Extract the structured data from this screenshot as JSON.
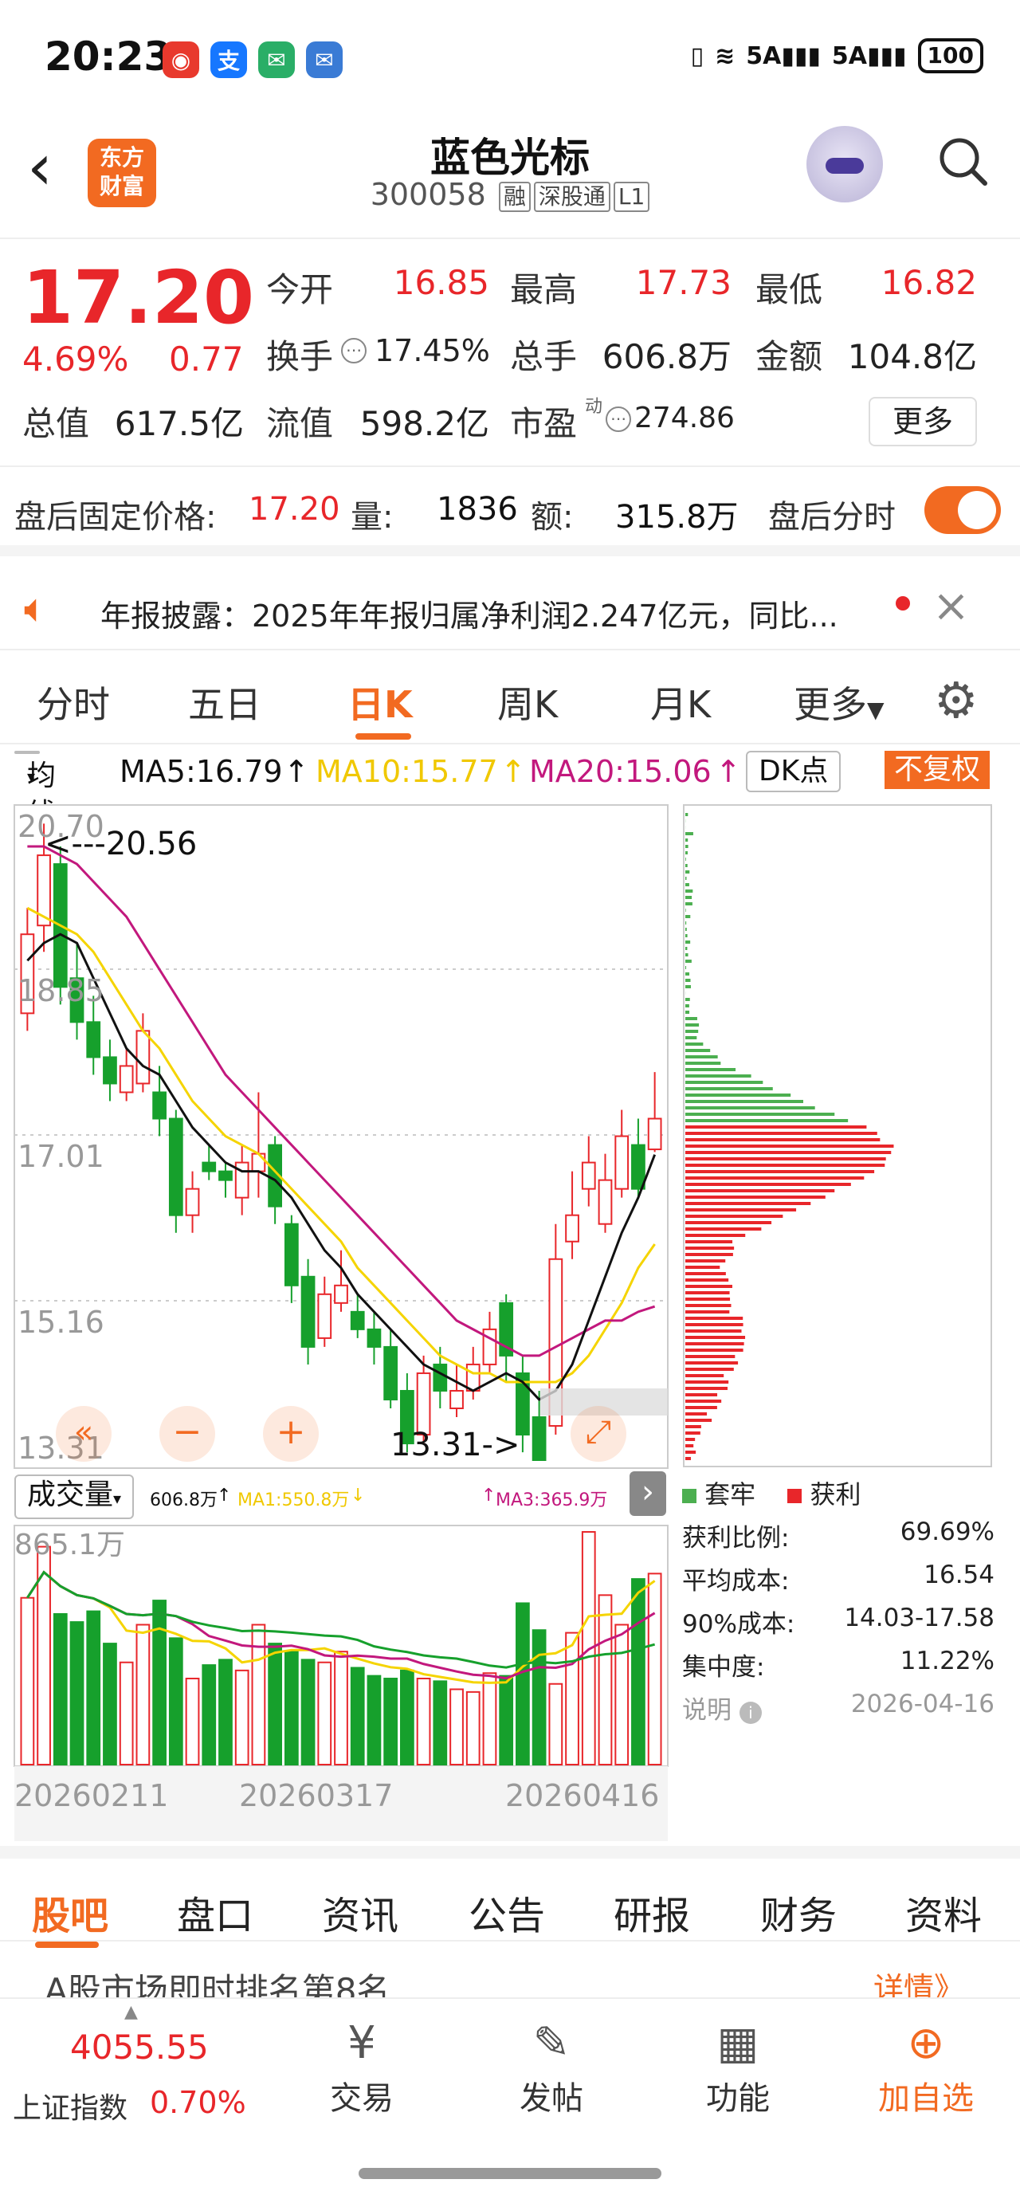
{
  "status": {
    "time": "20:23",
    "battery": "100",
    "net1": "5A",
    "net2": "5A"
  },
  "header": {
    "title": "蓝色光标",
    "code": "300058",
    "tags": [
      "融",
      "深股通",
      "L1"
    ],
    "logo_line1": "东方",
    "logo_line2": "财富"
  },
  "quote": {
    "price": "17.20",
    "pct": "4.69%",
    "change": "0.77",
    "open_label": "今开",
    "open": "16.85",
    "high_label": "最高",
    "high": "17.73",
    "low_label": "最低",
    "low": "16.82",
    "turnover_label": "换手",
    "turnover": "17.45%",
    "volume_label": "总手",
    "volume": "606.8万",
    "amount_label": "金额",
    "amount": "104.8亿",
    "mcap_label": "总值",
    "mcap": "617.5亿",
    "float_label": "流值",
    "float": "598.2亿",
    "pe_label": "市盈",
    "pe_sup": "动",
    "pe": "274.86",
    "more": "更多"
  },
  "after_hours": {
    "label": "盘后固定价格:",
    "price": "17.20",
    "vol_label": "量:",
    "vol": "1836",
    "amt_label": "额:",
    "amt": "315.8万",
    "switch_label": "盘后分时"
  },
  "notice": {
    "text": "年报披露：2025年年报归属净利润2.247亿元，同比..."
  },
  "chart_tabs": [
    "分时",
    "五日",
    "日K",
    "周K",
    "月K",
    "更多"
  ],
  "ma_row": {
    "select": "均线",
    "ma5": "MA5:16.79",
    "ma10": "MA10:15.77",
    "ma20": "MA20:15.06",
    "dk": "DK点",
    "fq": "不复权"
  },
  "colors": {
    "up": "#e8262a",
    "down": "#16a02c",
    "accent": "#f26a21",
    "ma5": "#111111",
    "ma10": "#f5d400",
    "ma20": "#c2187d"
  },
  "kline": {
    "y_ticks": [
      "20.70",
      "18.85",
      "17.01",
      "15.16",
      "13.31"
    ],
    "high_note": "<---20.56",
    "low_note": "13.31->",
    "x_dates": [
      "20260211",
      "20260317",
      "20260416"
    ]
  },
  "volume": {
    "select": "成交量",
    "vol": "606.8万",
    "ma1": "MA1:550.8万",
    "ma3": "MA3:365.9万",
    "max": "865.1万"
  },
  "distribution": {
    "legend_trap": "套牢",
    "legend_profit": "获利",
    "rows": [
      {
        "label": "获利比例:",
        "value": "69.69%"
      },
      {
        "label": "平均成本:",
        "value": "16.54"
      },
      {
        "label": "90%成本:",
        "value": "14.03-17.58"
      },
      {
        "label": "集中度:",
        "value": "11.22%"
      }
    ],
    "note_label": "说明",
    "date": "2026-04-16"
  },
  "bottom_tabs": [
    "股吧",
    "盘口",
    "资讯",
    "公告",
    "研报",
    "财务",
    "资料"
  ],
  "rank": {
    "text": "A股市场即时排名第8名",
    "more": "详情》"
  },
  "index": {
    "value": "4055.55",
    "name": "上证指数",
    "pct": "0.70%"
  },
  "nav": [
    "交易",
    "发帖",
    "功能",
    "加自选"
  ],
  "chart_data": {
    "type": "candlestick",
    "x_range": [
      "20260211",
      "20260416"
    ],
    "ylim": [
      13.31,
      20.7
    ],
    "candles": [
      {
        "o": 18.4,
        "c": 19.3,
        "h": 19.6,
        "l": 18.2
      },
      {
        "o": 19.4,
        "c": 20.2,
        "h": 20.56,
        "l": 19.1
      },
      {
        "o": 20.1,
        "c": 18.7,
        "h": 20.3,
        "l": 18.5
      },
      {
        "o": 18.8,
        "c": 18.3,
        "h": 19.2,
        "l": 18.1
      },
      {
        "o": 18.3,
        "c": 17.9,
        "h": 18.6,
        "l": 17.7
      },
      {
        "o": 17.9,
        "c": 17.6,
        "h": 18.1,
        "l": 17.4
      },
      {
        "o": 17.5,
        "c": 17.8,
        "h": 18.0,
        "l": 17.4
      },
      {
        "o": 17.6,
        "c": 18.2,
        "h": 18.4,
        "l": 17.5
      },
      {
        "o": 17.5,
        "c": 17.2,
        "h": 17.8,
        "l": 17.0
      },
      {
        "o": 17.2,
        "c": 16.1,
        "h": 17.3,
        "l": 15.9
      },
      {
        "o": 16.1,
        "c": 16.4,
        "h": 16.6,
        "l": 15.9
      },
      {
        "o": 16.7,
        "c": 16.6,
        "h": 16.9,
        "l": 16.5
      },
      {
        "o": 16.6,
        "c": 16.5,
        "h": 16.7,
        "l": 16.3
      },
      {
        "o": 16.3,
        "c": 16.7,
        "h": 16.9,
        "l": 16.1
      },
      {
        "o": 16.6,
        "c": 16.8,
        "h": 17.5,
        "l": 16.3
      },
      {
        "o": 16.9,
        "c": 16.2,
        "h": 17.0,
        "l": 16.0
      },
      {
        "o": 16.0,
        "c": 15.3,
        "h": 16.1,
        "l": 15.1
      },
      {
        "o": 15.4,
        "c": 14.6,
        "h": 15.6,
        "l": 14.4
      },
      {
        "o": 14.7,
        "c": 15.2,
        "h": 15.4,
        "l": 14.6
      },
      {
        "o": 15.1,
        "c": 15.3,
        "h": 15.7,
        "l": 15.0
      },
      {
        "o": 15.0,
        "c": 14.8,
        "h": 15.2,
        "l": 14.7
      },
      {
        "o": 14.8,
        "c": 14.6,
        "h": 15.0,
        "l": 14.4
      },
      {
        "o": 14.6,
        "c": 14.0,
        "h": 14.8,
        "l": 13.9
      },
      {
        "o": 14.1,
        "c": 13.5,
        "h": 14.3,
        "l": 13.4
      },
      {
        "o": 13.6,
        "c": 14.3,
        "h": 14.5,
        "l": 13.5
      },
      {
        "o": 14.4,
        "c": 14.1,
        "h": 14.6,
        "l": 13.9
      },
      {
        "o": 13.9,
        "c": 14.1,
        "h": 14.4,
        "l": 13.8
      },
      {
        "o": 14.1,
        "c": 14.4,
        "h": 14.6,
        "l": 14.0
      },
      {
        "o": 14.4,
        "c": 14.8,
        "h": 15.0,
        "l": 14.3
      },
      {
        "o": 15.1,
        "c": 14.5,
        "h": 15.2,
        "l": 14.2
      },
      {
        "o": 14.3,
        "c": 13.6,
        "h": 14.5,
        "l": 13.4
      },
      {
        "o": 13.8,
        "c": 13.31,
        "h": 14.1,
        "l": 13.31
      },
      {
        "o": 13.7,
        "c": 15.6,
        "h": 16.0,
        "l": 13.6
      },
      {
        "o": 15.8,
        "c": 16.1,
        "h": 16.6,
        "l": 15.6
      },
      {
        "o": 16.4,
        "c": 16.7,
        "h": 17.0,
        "l": 16.2
      },
      {
        "o": 16.0,
        "c": 16.5,
        "h": 16.8,
        "l": 15.9
      },
      {
        "o": 16.4,
        "c": 17.0,
        "h": 17.3,
        "l": 16.3
      },
      {
        "o": 16.9,
        "c": 16.4,
        "h": 17.2,
        "l": 16.3
      },
      {
        "o": 16.85,
        "c": 17.2,
        "h": 17.73,
        "l": 16.82
      }
    ],
    "ma5": [
      19.0,
      19.2,
      19.3,
      19.2,
      18.8,
      18.4,
      18.0,
      17.8,
      17.7,
      17.4,
      17.1,
      16.9,
      16.7,
      16.6,
      16.6,
      16.5,
      16.3,
      16.0,
      15.7,
      15.5,
      15.2,
      15.0,
      14.8,
      14.6,
      14.4,
      14.3,
      14.2,
      14.1,
      14.2,
      14.3,
      14.2,
      14.0,
      14.1,
      14.4,
      14.9,
      15.4,
      15.9,
      16.3,
      16.79
    ],
    "ma10": [
      19.6,
      19.5,
      19.4,
      19.3,
      19.1,
      18.8,
      18.5,
      18.2,
      18.0,
      17.7,
      17.4,
      17.2,
      17.0,
      16.9,
      16.8,
      16.6,
      16.4,
      16.2,
      16.0,
      15.8,
      15.5,
      15.3,
      15.1,
      14.9,
      14.7,
      14.5,
      14.4,
      14.3,
      14.3,
      14.2,
      14.2,
      14.2,
      14.2,
      14.3,
      14.5,
      14.8,
      15.1,
      15.5,
      15.77
    ],
    "ma20": [
      20.3,
      20.3,
      20.2,
      20.1,
      19.9,
      19.7,
      19.5,
      19.2,
      18.9,
      18.6,
      18.3,
      18.0,
      17.7,
      17.5,
      17.3,
      17.1,
      16.9,
      16.7,
      16.5,
      16.3,
      16.1,
      15.9,
      15.7,
      15.5,
      15.3,
      15.1,
      14.9,
      14.8,
      14.7,
      14.6,
      14.5,
      14.5,
      14.6,
      14.7,
      14.8,
      14.9,
      14.9,
      15.0,
      15.06
    ],
    "volume": [
      6.2,
      8.1,
      5.6,
      5.3,
      5.7,
      4.5,
      3.8,
      5.2,
      6.1,
      4.7,
      3.2,
      3.7,
      3.9,
      3.5,
      5.2,
      4.5,
      4.2,
      3.9,
      3.8,
      4.2,
      3.6,
      3.3,
      3.2,
      3.5,
      3.2,
      3.1,
      2.8,
      2.7,
      3.4,
      3.3,
      6.0,
      5.0,
      3.0,
      4.9,
      8.65,
      6.3,
      5.2,
      6.9,
      7.1
    ],
    "vol_ylim": [
      0,
      8.651
    ],
    "vol_unit": "百万"
  }
}
